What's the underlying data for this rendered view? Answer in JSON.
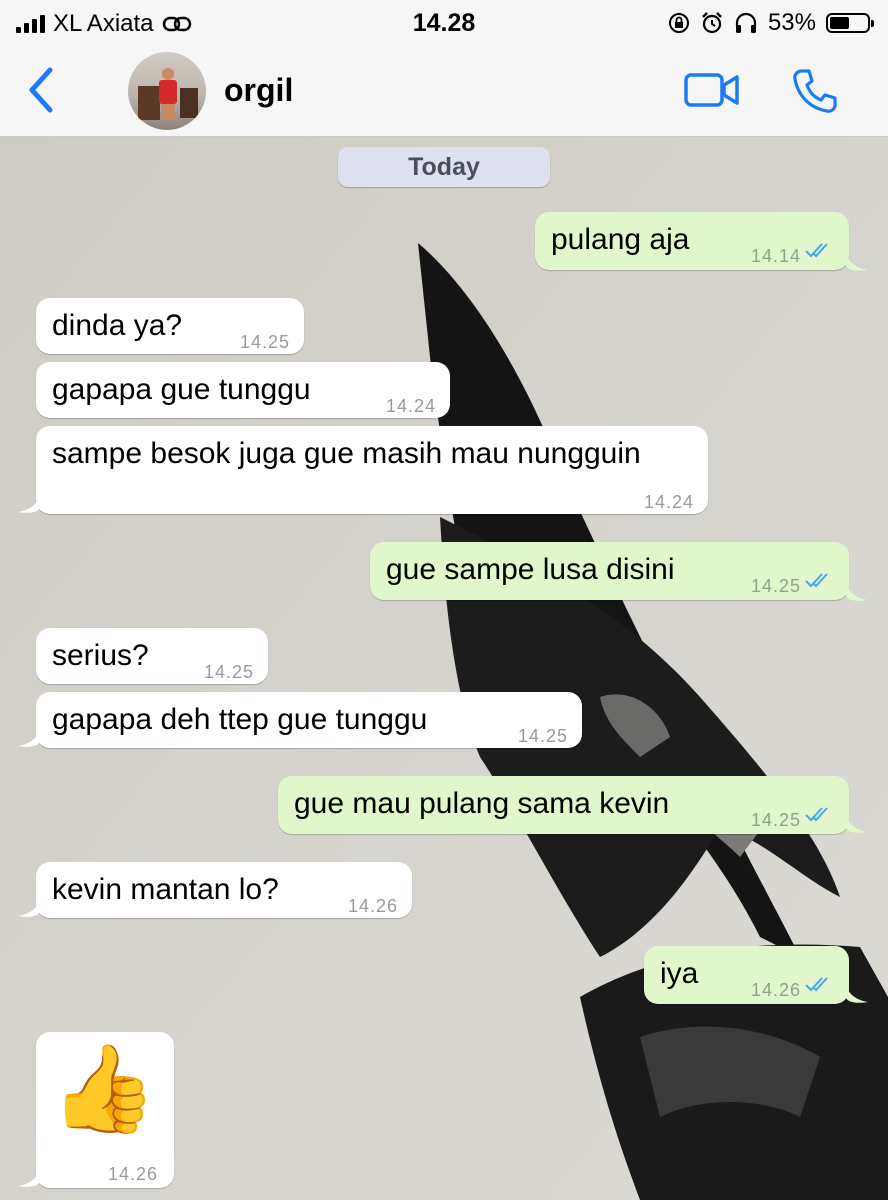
{
  "status_bar": {
    "carrier": "XL Axiata",
    "time": "14.28",
    "battery": "53%",
    "battery_level": 0.53
  },
  "header": {
    "contact_name": "orgil",
    "icons": [
      "back-chevron-icon",
      "video-call-icon",
      "phone-call-icon"
    ]
  },
  "date_label": "Today",
  "colors": {
    "accent": "#1a7cf5",
    "outgoing_bubble": "#e1f6cb",
    "incoming_bubble": "#ffffff",
    "read_tick": "#4aa3f0"
  },
  "messages": [
    {
      "direction": "out",
      "text": "pulang aja",
      "time": "14.14",
      "read": true
    },
    {
      "direction": "in",
      "text": "dinda ya?",
      "time": "14.25"
    },
    {
      "direction": "in",
      "text": "gapapa gue tunggu",
      "time": "14.24"
    },
    {
      "direction": "in",
      "text": "sampe besok juga gue masih mau nungguin",
      "time": "14.24"
    },
    {
      "direction": "out",
      "text": "gue sampe lusa disini",
      "time": "14.25",
      "read": true
    },
    {
      "direction": "in",
      "text": "serius?",
      "time": "14.25"
    },
    {
      "direction": "in",
      "text": "gapapa deh ttep gue tunggu",
      "time": "14.25"
    },
    {
      "direction": "out",
      "text": "gue mau pulang sama kevin",
      "time": "14.25",
      "read": true
    },
    {
      "direction": "in",
      "text": "kevin mantan lo?",
      "time": "14.26"
    },
    {
      "direction": "out",
      "text": "iya",
      "time": "14.26",
      "read": true
    },
    {
      "direction": "in",
      "text": "👍",
      "time": "14.26",
      "type": "emoji"
    }
  ]
}
